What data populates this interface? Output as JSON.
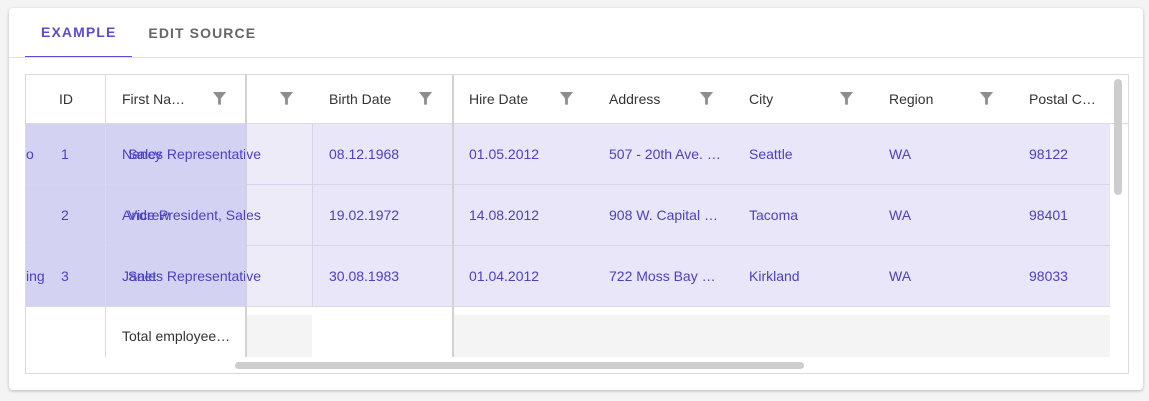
{
  "tabs": {
    "example": "EXAMPLE",
    "edit_source": "EDIT SOURCE"
  },
  "columns": {
    "id": "ID",
    "first_name": "First Na…",
    "birth_date": "Birth Date",
    "hire_date": "Hire Date",
    "address": "Address",
    "city": "City",
    "region": "Region",
    "postal_code": "Postal C…"
  },
  "rows": [
    {
      "left_clip": "o",
      "id": "1",
      "first_name": "Nancy",
      "title": "Sales Representative",
      "birth_date": "08.12.1968",
      "hire_date": "01.05.2012",
      "address": "507 - 20th Ave. …",
      "city": "Seattle",
      "region": "WA",
      "postal_code": "98122"
    },
    {
      "left_clip": "",
      "id": "2",
      "first_name": "Andrew",
      "title": "Vice President, Sales",
      "birth_date": "19.02.1972",
      "hire_date": "14.08.2012",
      "address": "908 W. Capital …",
      "city": "Tacoma",
      "region": "WA",
      "postal_code": "98401"
    },
    {
      "left_clip": "ing",
      "id": "3",
      "first_name": "Janet",
      "title": "Sales Representative",
      "birth_date": "30.08.1983",
      "hire_date": "01.04.2012",
      "address": "722 Moss Bay …",
      "city": "Kirkland",
      "region": "WA",
      "postal_code": "98033"
    }
  ],
  "footer": {
    "total_employees": "Total employee…"
  },
  "colors": {
    "accent": "#5b4dd3",
    "selection": "#e8e6f8",
    "pinned_selection": "#d4d2f3",
    "cell_text": "#4b42c2"
  },
  "icons": {
    "filter": "filter-icon"
  }
}
